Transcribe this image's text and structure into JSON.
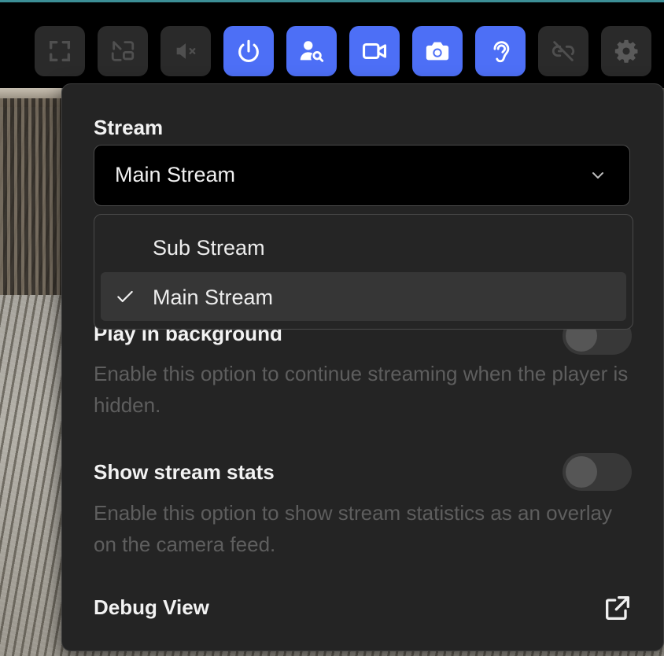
{
  "toolbar": {
    "buttons": [
      {
        "name": "fullscreen-button",
        "icon": "fullscreen-icon",
        "active": false
      },
      {
        "name": "pip-button",
        "icon": "picture-in-picture-icon",
        "active": false
      },
      {
        "name": "mute-button",
        "icon": "speaker-muted-icon",
        "active": false
      },
      {
        "name": "power-button",
        "icon": "power-icon",
        "active": true
      },
      {
        "name": "person-search-button",
        "icon": "person-search-icon",
        "active": true
      },
      {
        "name": "record-button",
        "icon": "video-camera-icon",
        "active": true
      },
      {
        "name": "snapshot-button",
        "icon": "camera-icon",
        "active": true
      },
      {
        "name": "listen-button",
        "icon": "ear-icon",
        "active": true
      },
      {
        "name": "unlink-button",
        "icon": "link-off-icon",
        "active": false
      },
      {
        "name": "settings-button",
        "icon": "gear-icon",
        "active": false
      }
    ],
    "active_color": "#4d6ff6",
    "inactive_color": "#2a2a2a"
  },
  "settings": {
    "stream_label": "Stream",
    "stream_selected": "Main Stream",
    "stream_options": [
      {
        "label": "Sub Stream",
        "selected": false
      },
      {
        "label": "Main Stream",
        "selected": true
      }
    ],
    "play_bg": {
      "title": "Play in background",
      "description": "Enable this option to continue streaming when the player is hidden.",
      "enabled": false
    },
    "stats": {
      "title": "Show stream stats",
      "description": "Enable this option to show stream statistics as an overlay on the camera feed.",
      "enabled": false
    },
    "debug": {
      "title": "Debug View",
      "icon": "external-link-icon"
    }
  }
}
